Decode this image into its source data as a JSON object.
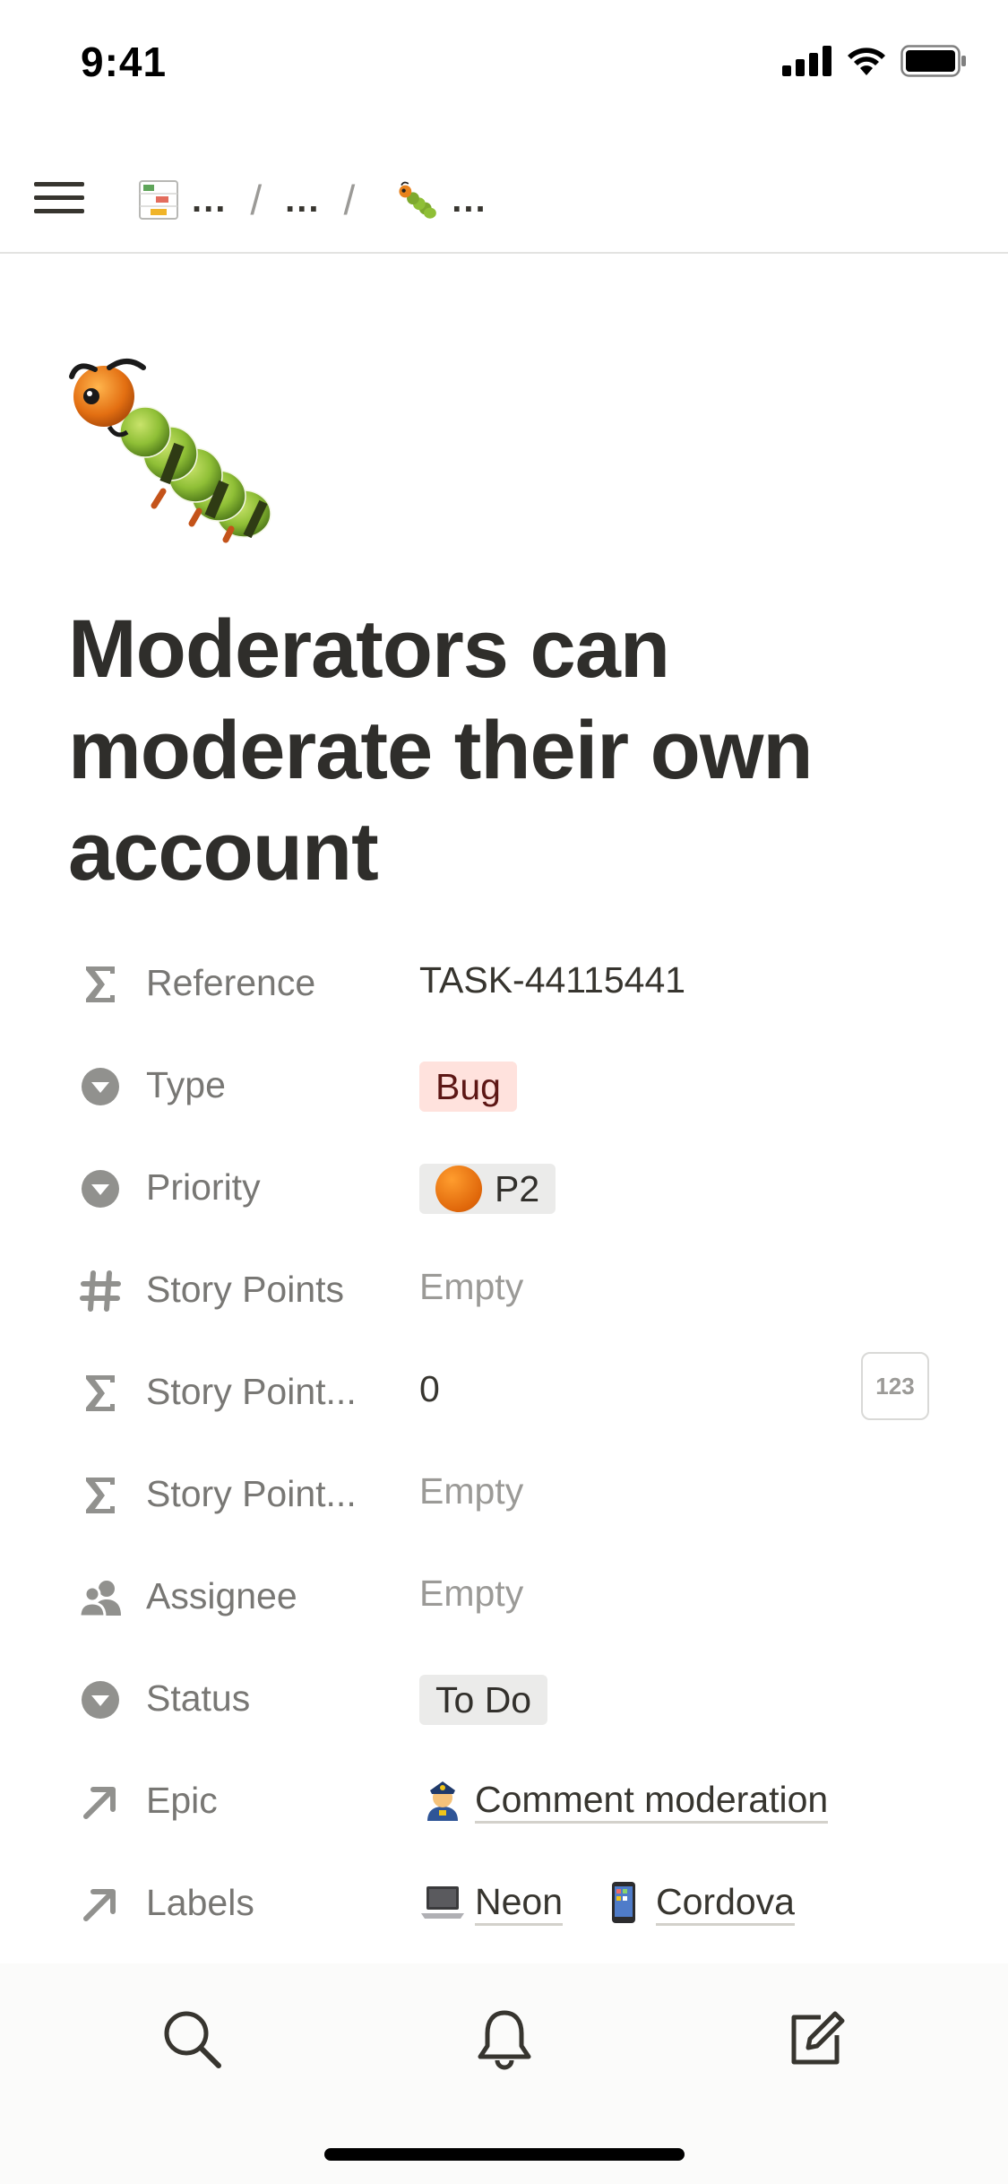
{
  "status_bar": {
    "time": "9:41"
  },
  "breadcrumb": {
    "items": [
      {
        "icon": "roadmap-icon",
        "label": "..."
      },
      {
        "icon": "",
        "label": "..."
      },
      {
        "icon": "caterpillar-icon",
        "label": "..."
      }
    ],
    "separator": "/"
  },
  "page": {
    "icon": "caterpillar-icon",
    "title": "Moderators can moderate their own account"
  },
  "properties": {
    "reference": {
      "label": "Reference",
      "value": "TASK-44115441",
      "icon": "sigma-icon"
    },
    "type": {
      "label": "Type",
      "value": "Bug",
      "icon": "select-icon",
      "color": "#ffe2dd"
    },
    "priority": {
      "label": "Priority",
      "value": "P2",
      "icon": "select-icon",
      "badge": "orange-circle-icon"
    },
    "story_points": {
      "label": "Story Points",
      "value": "Empty",
      "icon": "hash-icon"
    },
    "story_points_rollup_1": {
      "label": "Story Point...",
      "value": "0",
      "icon": "sigma-icon",
      "format_button": "123"
    },
    "story_points_rollup_2": {
      "label": "Story Point...",
      "value": "Empty",
      "icon": "sigma-icon"
    },
    "assignee": {
      "label": "Assignee",
      "value": "Empty",
      "icon": "people-icon"
    },
    "status": {
      "label": "Status",
      "value": "To Do",
      "icon": "select-icon"
    },
    "epic": {
      "label": "Epic",
      "icon": "relation-arrow-icon",
      "links": [
        {
          "emoji": "police-officer-icon",
          "text": "Comment moderation"
        }
      ]
    },
    "labels": {
      "label": "Labels",
      "icon": "relation-arrow-icon",
      "links": [
        {
          "emoji": "laptop-icon",
          "text": "Neon"
        },
        {
          "emoji": "mobile-phone-icon",
          "text": "Cordova"
        }
      ]
    }
  },
  "bottom_bar": {
    "tabs": [
      "search-icon",
      "bell-icon",
      "compose-icon"
    ]
  },
  "colors": {
    "accent_text": "#37352f",
    "muted_text": "#787774",
    "bug_tag_bg": "#ffe2dd",
    "gray_tag_bg": "#ebebea"
  }
}
